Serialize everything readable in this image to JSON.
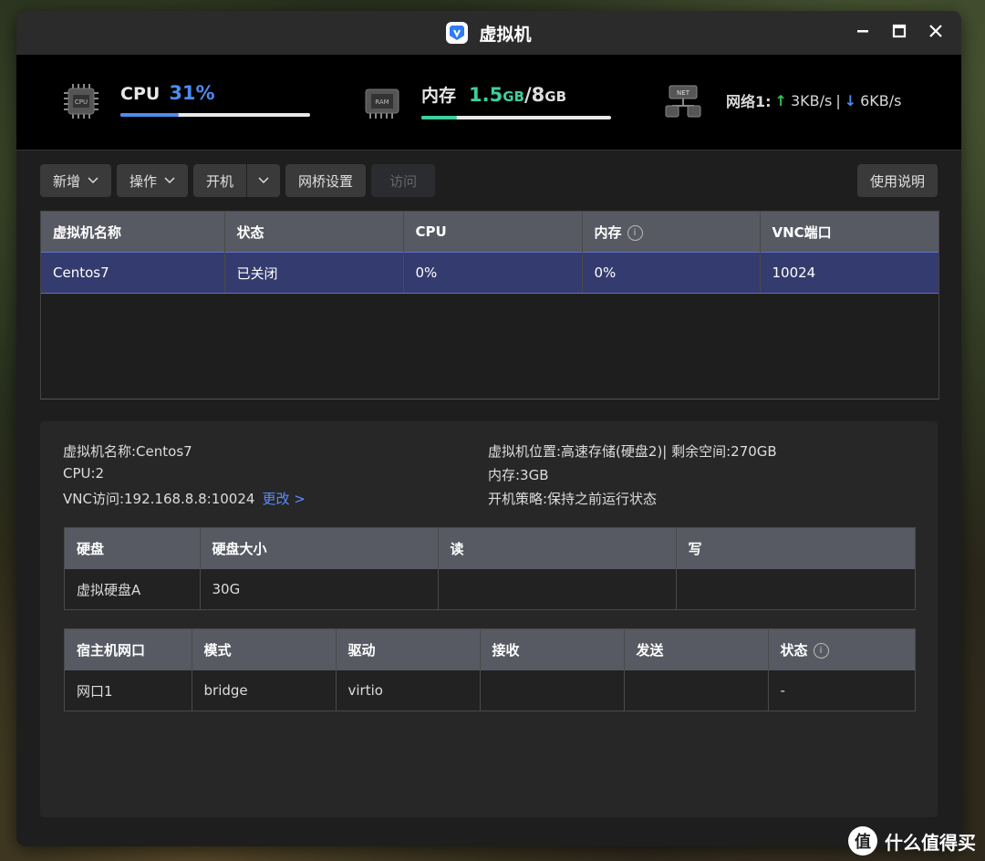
{
  "window": {
    "title": "虚拟机"
  },
  "stats": {
    "cpu": {
      "label": "CPU",
      "value": "31%",
      "fraction": 0.31,
      "icon_text": "CPU"
    },
    "memory": {
      "label": "内存",
      "used": "1.5",
      "used_unit": "GB",
      "sep": "/",
      "total": "8",
      "total_unit": "GB",
      "fraction": 0.1875,
      "icon_text": "RAM"
    },
    "network": {
      "label": "网络1:",
      "up": "3KB/s",
      "sep": "|",
      "down": "6KB/s",
      "icon_text": "NET"
    }
  },
  "toolbar": {
    "add_label": "新增",
    "action_label": "操作",
    "power_label": "开机",
    "bridge_label": "网桥设置",
    "visit_label": "访问",
    "help_label": "使用说明"
  },
  "vm_table": {
    "headers": [
      "虚拟机名称",
      "状态",
      "CPU",
      "内存",
      "VNC端口"
    ],
    "rows": [
      [
        "Centos7",
        "已关闭",
        "0%",
        "0%",
        "10024"
      ]
    ]
  },
  "details": {
    "name": "虚拟机名称:Centos7",
    "location": "虚拟机位置:高速存储(硬盘2)| 剩余空间:270GB",
    "cpu": "CPU:2",
    "memory": "内存:3GB",
    "vnc": "VNC访问:192.168.8.8:10024",
    "change_link": "更改 >",
    "boot_policy": "开机策略:保持之前运行状态"
  },
  "disk_table": {
    "headers": [
      "硬盘",
      "硬盘大小",
      "读",
      "写"
    ],
    "rows": [
      [
        "虚拟硬盘A",
        "30G",
        "",
        ""
      ]
    ]
  },
  "nic_table": {
    "headers": [
      "宿主机网口",
      "模式",
      "驱动",
      "接收",
      "发送",
      "状态"
    ],
    "rows": [
      [
        "网口1",
        "bridge",
        "virtio",
        "",
        "",
        "-"
      ]
    ]
  },
  "watermark": {
    "text": "什么值得买",
    "icon": "值"
  },
  "colors": {
    "cpu_accent": "#4d8cf0",
    "mem_accent": "#3ecf9e",
    "selected_row": "#343b6e",
    "up_arrow": "#32c24d",
    "down_arrow": "#4d8cf0"
  }
}
